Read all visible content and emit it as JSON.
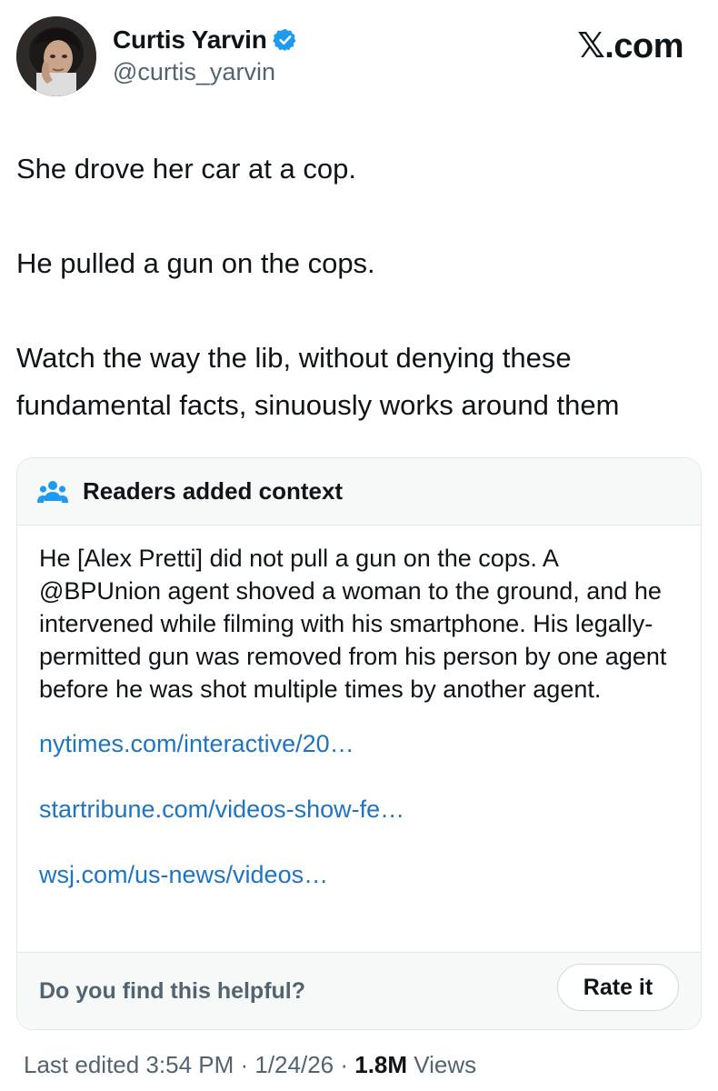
{
  "author": {
    "name": "Curtis Yarvin",
    "handle": "@curtis_yarvin",
    "verified": true,
    "verified_color": "#1d9bf0"
  },
  "source_logo": "𝕏.com",
  "tweet": {
    "paragraphs": [
      "She drove her car at a cop.",
      "He pulled a gun on the cops.",
      "Watch the way the lib, without denying these fundamental facts, sinuously works around them"
    ]
  },
  "community_note": {
    "icon": "people-icon",
    "title": "Readers added context",
    "body": "He [Alex Pretti] did not pull a gun on the cops.  A @BPUnion agent shoved a woman to the ground, and he intervened while filming with his smartphone.  His legally-permitted gun was removed from his person by one agent before he was shot multiple times by another agent.",
    "links": [
      "nytimes.com/interactive/20…",
      "startribune.com/videos-show-fe…",
      "wsj.com/us-news/videos…"
    ],
    "footer_question": "Do you find this helpful?",
    "rate_button": "Rate it",
    "link_color": "#1d74c4"
  },
  "meta": {
    "edited_label": "Last edited 3:54 PM · 1/24/26",
    "separator": " · ",
    "views_count": "1.8M",
    "views_label": " Views"
  }
}
